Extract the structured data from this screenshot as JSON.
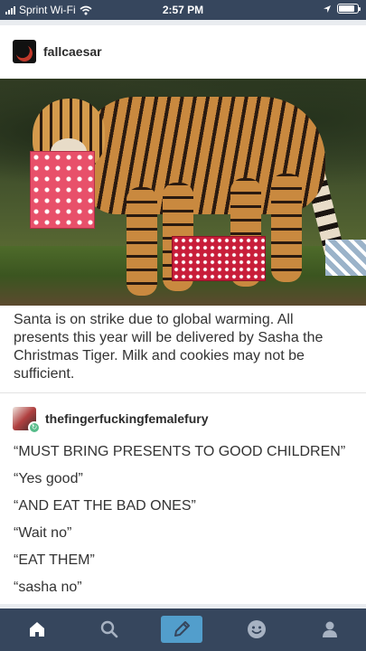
{
  "status_bar": {
    "carrier": "Sprint Wi-Fi",
    "time": "2:57 PM",
    "battery_level": 0.85
  },
  "post": {
    "author": "fallcaesar",
    "caption": "Santa is on strike due to global warming.  All presents this year will be delivered by Sasha the Christmas Tiger.  Milk and cookies may not be sufficient.",
    "reblog": {
      "author": "thefingerfuckingfemalefury",
      "lines": [
        "“MUST BRING PRESENTS TO GOOD CHILDREN”",
        "“Yes good”",
        "“AND EAT THE BAD ONES”",
        "“Wait no”",
        "“EAT THEM”",
        "“sasha no”"
      ]
    }
  },
  "tab_bar": {
    "icons": [
      "home-icon",
      "search-icon",
      "compose-icon",
      "activity-icon",
      "account-icon"
    ],
    "active_color": "#529ecc",
    "bar_color": "#36465d"
  }
}
